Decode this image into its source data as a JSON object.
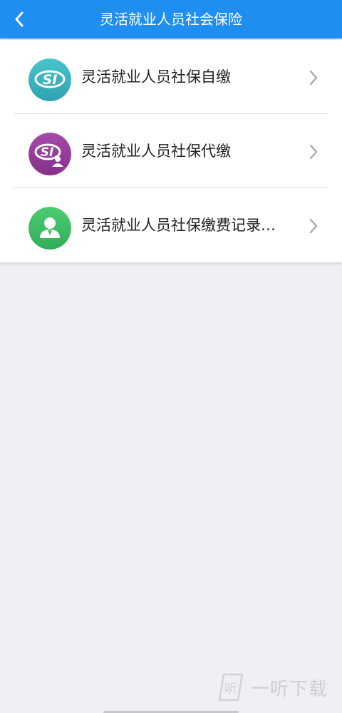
{
  "header": {
    "title": "灵活就业人员社会保险",
    "back_icon": "chevron-left-icon"
  },
  "list": {
    "items": [
      {
        "label": "灵活就业人员社保自缴",
        "icon": "si-logo-icon",
        "icon_color": "#3fb6c1",
        "chevron_icon": "chevron-right-icon"
      },
      {
        "label": "灵活就业人员社保代缴",
        "icon": "si-agent-icon",
        "icon_color": "#9a3e9d",
        "chevron_icon": "chevron-right-icon"
      },
      {
        "label": "灵活就业人员社保缴费记录…",
        "icon": "person-record-icon",
        "icon_color": "#3fbf69",
        "chevron_icon": "chevron-right-icon"
      }
    ]
  },
  "watermark": {
    "text": "一听下载",
    "logo_char": "听"
  },
  "colors": {
    "header_bg": "#1e8ef1",
    "page_bg": "#efeff4"
  }
}
